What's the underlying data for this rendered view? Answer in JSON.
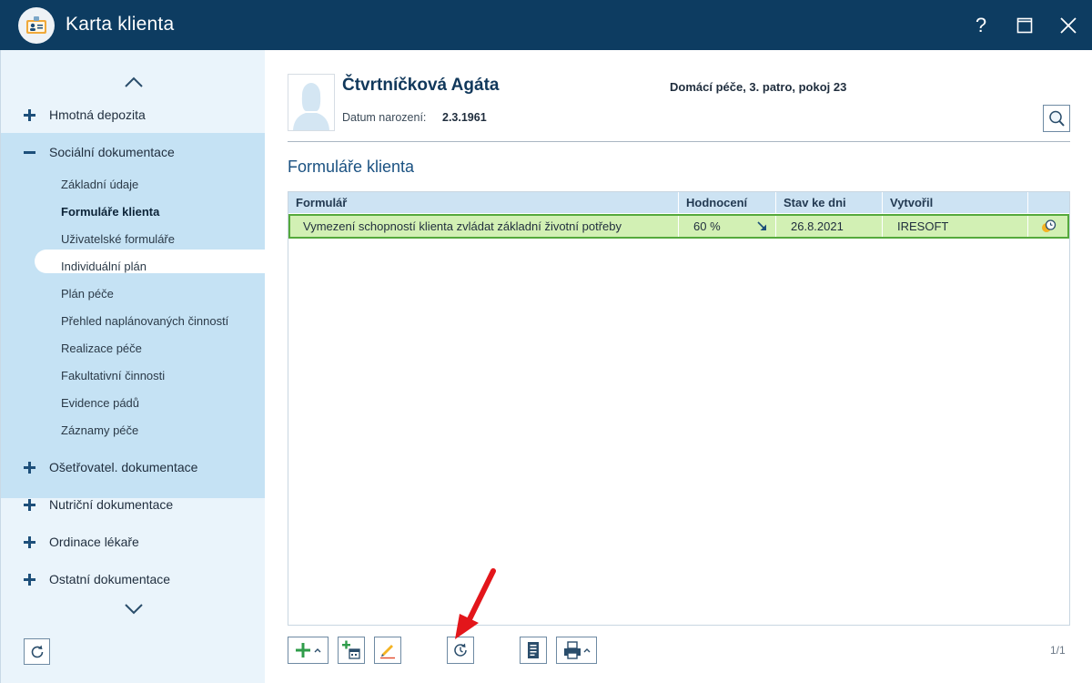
{
  "window": {
    "title": "Karta klienta",
    "help_label": "?"
  },
  "sidebar": {
    "sections": [
      {
        "label": "Hmotná depozita",
        "expanded": false
      },
      {
        "label": "Sociální dokumentace",
        "expanded": true
      },
      {
        "label": "Ošetřovatel. dokumentace",
        "expanded": false
      },
      {
        "label": "Nutriční dokumentace",
        "expanded": false
      },
      {
        "label": "Ordinace lékaře",
        "expanded": false
      },
      {
        "label": "Ostatní dokumentace",
        "expanded": false
      }
    ],
    "sub_items": [
      "Základní údaje",
      "Formuláře klienta",
      "Uživatelské formuláře",
      "Individuální plán",
      "Plán péče",
      "Přehled naplánovaných činností",
      "Realizace péče",
      "Fakultativní činnosti",
      "Evidence pádů",
      "Záznamy péče"
    ],
    "active_sub_item": "Formuláře klienta"
  },
  "client": {
    "name": "Čtvrtníčková Agáta",
    "location": "Domácí péče, 3. patro, pokoj 23",
    "dob_label": "Datum narození:",
    "dob_value": "2.3.1961"
  },
  "main": {
    "section_title": "Formuláře klienta"
  },
  "table": {
    "columns": [
      "Formulář",
      "Hodnocení",
      "Stav ke dni",
      "Vytvořil"
    ],
    "rows": [
      {
        "form": "Vymezení schopností klienta zvládat základní životní potřeby",
        "rating": "60 %",
        "trend": "down-right",
        "date": "26.8.2021",
        "author": "IRESOFT"
      }
    ]
  },
  "pager": "1/1",
  "colors": {
    "titlebar": "#0d3c61",
    "sidebar": "#eaf4fb",
    "expanded_section": "#c5e2f4",
    "row_selected": "#d2f0b4",
    "row_border": "#55a93c",
    "accent": "#1b5282",
    "annotation_arrow": "#e3161b"
  },
  "icons": {
    "app": "client-card-icon",
    "help": "help-icon",
    "maximize": "maximize-icon",
    "close": "close-icon",
    "refresh": "refresh-icon",
    "search": "search-icon",
    "add": "add-icon",
    "add_dated": "add-calendar-icon",
    "edit": "pencil-icon",
    "history": "history-clock-icon",
    "document": "document-icon",
    "print": "printer-icon",
    "row_status": "reminder-clock-icon",
    "trend": "arrow-down-right-icon"
  }
}
